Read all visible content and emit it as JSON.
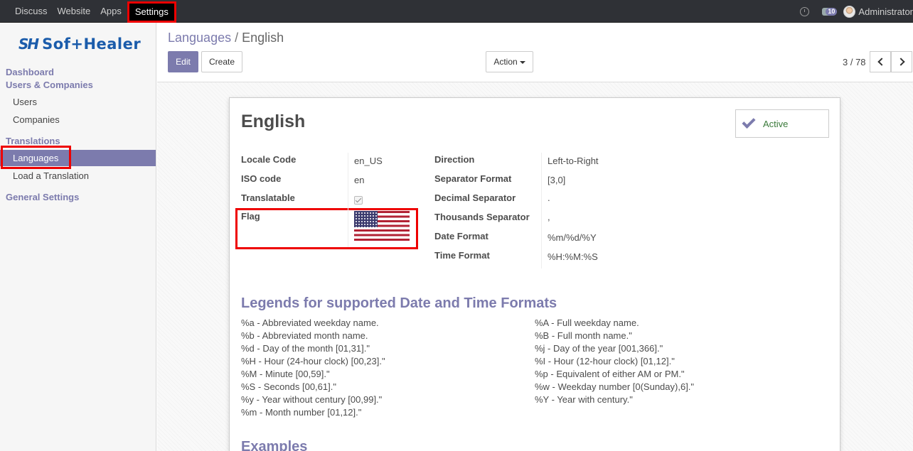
{
  "topbar": {
    "menu": [
      "Discuss",
      "Website",
      "Apps",
      "Settings"
    ],
    "active_menu": "Settings",
    "notification_count": "10",
    "user": "Administrator"
  },
  "sidebar": {
    "logo_mark": "SH",
    "logo_text": "Sof+Healer",
    "sections": [
      {
        "label": "Dashboard"
      },
      {
        "label": "Users & Companies",
        "items": [
          "Users",
          "Companies"
        ]
      },
      {
        "label": "Translations",
        "items": [
          "Languages",
          "Load a Translation"
        ]
      },
      {
        "label": "General Settings"
      }
    ],
    "active_item": "Languages"
  },
  "breadcrumb": {
    "parent": "Languages",
    "separator": "/",
    "current": "English"
  },
  "buttons": {
    "edit": "Edit",
    "create": "Create",
    "action": "Action"
  },
  "pager": "3 / 78",
  "record": {
    "title": "English",
    "active_label": "Active",
    "left_fields": [
      {
        "label": "Locale Code",
        "value": "en_US"
      },
      {
        "label": "ISO code",
        "value": "en"
      },
      {
        "label": "Translatable",
        "value": true
      },
      {
        "label": "Flag",
        "value": "US flag"
      }
    ],
    "right_fields": [
      {
        "label": "Direction",
        "value": "Left-to-Right"
      },
      {
        "label": "Separator Format",
        "value": "[3,0]"
      },
      {
        "label": "Decimal Separator",
        "value": "."
      },
      {
        "label": "Thousands Separator",
        "value": ","
      },
      {
        "label": "Date Format",
        "value": "%m/%d/%Y"
      },
      {
        "label": "Time Format",
        "value": "%H:%M:%S"
      }
    ]
  },
  "legends": {
    "title": "Legends for supported Date and Time Formats",
    "left": [
      "%a - Abbreviated weekday name.",
      "%b - Abbreviated month name.",
      "%d - Day of the month [01,31].\"",
      "%H - Hour (24-hour clock) [00,23].\"",
      "%M - Minute [00,59].\"",
      "%S - Seconds [00,61].\"",
      "%y - Year without century [00,99].\"",
      "%m - Month number [01,12].\""
    ],
    "right": [
      "%A - Full weekday name.",
      "%B - Full month name.\"",
      "%j - Day of the year [001,366].\"",
      "%I - Hour (12-hour clock) [01,12].\"",
      "%p - Equivalent of either AM or PM.\"",
      "%w - Weekday number [0(Sunday),6].\"",
      "%Y - Year with century.\""
    ]
  },
  "examples_title": "Examples",
  "colors": {
    "accent": "#7c7bad",
    "highlight": "#e00000",
    "topbar": "#2f3136"
  }
}
